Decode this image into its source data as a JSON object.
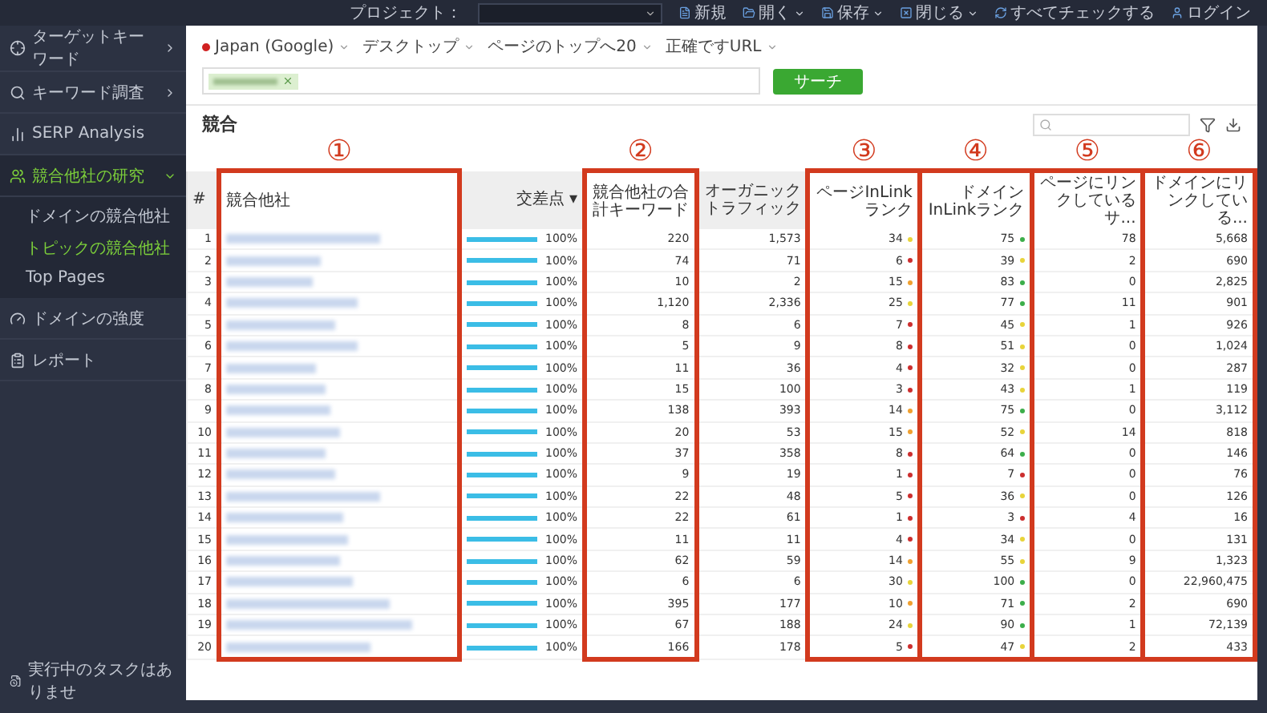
{
  "top_bar": {
    "project_label": "プロジェクト：",
    "actions": [
      {
        "label": "新規",
        "dropdown": false
      },
      {
        "label": "開く",
        "dropdown": true
      },
      {
        "label": "保存",
        "dropdown": true
      },
      {
        "label": "閉じる",
        "dropdown": true
      },
      {
        "label": "すべてチェックする",
        "dropdown": false
      },
      {
        "label": "ログイン",
        "dropdown": false
      }
    ]
  },
  "sidebar": {
    "items": [
      {
        "label": "ターゲットキーワード",
        "selected": false,
        "expanded": false
      },
      {
        "label": "キーワード調査",
        "selected": false,
        "expanded": false
      },
      {
        "label": "SERP Analysis",
        "selected": false
      },
      {
        "label": "競合他社の研究",
        "selected": true,
        "expanded": true,
        "children": [
          {
            "label": "ドメインの競合他社",
            "selected": false
          },
          {
            "label": "トピックの競合他社",
            "selected": true
          },
          {
            "label": "Top Pages",
            "selected": false
          }
        ]
      },
      {
        "label": "ドメインの強度",
        "selected": false
      },
      {
        "label": "レポート",
        "selected": false
      }
    ],
    "status": "実行中のタスクはありませ"
  },
  "filters": [
    {
      "label": "Japan (Google)",
      "flag": true
    },
    {
      "label": "デスクトップ",
      "flag": false
    },
    {
      "label": "ページのトップへ20",
      "flag": false
    },
    {
      "label": "正確ですURL",
      "flag": false
    }
  ],
  "search": {
    "button": "サーチ"
  },
  "results": {
    "title": "競合",
    "columns": [
      {
        "label": "#",
        "highlight": false
      },
      {
        "label": "競合他社",
        "highlight": true,
        "callout": "①"
      },
      {
        "label": "交差点 ▾",
        "highlight": false
      },
      {
        "label": "競合他社の合計キーワード",
        "highlight": true,
        "callout": "②"
      },
      {
        "label": "オーガニックトラフィック",
        "highlight": false
      },
      {
        "label": "ページInLinkランク",
        "highlight": true,
        "callout": "③"
      },
      {
        "label": "ドメインInLinkランク",
        "highlight": true,
        "callout": "④"
      },
      {
        "label": "ページにリンクしているサ...",
        "highlight": true,
        "callout": "⑤"
      },
      {
        "label": "ドメインにリンクしている...",
        "highlight": true,
        "callout": "⑥"
      }
    ],
    "rows": [
      {
        "n": "1",
        "level": 1,
        "reading": "100%",
        "keywords": "220",
        "traffic": "1,573",
        "page_rank": {
          "value": "34",
          "color": "#e8d43a"
        },
        "domain_rank": {
          "value": "75",
          "color": "#3cae4a"
        },
        "page_links": "78",
        "domain_links": "5,668"
      },
      {
        "n": "2",
        "level": 1,
        "reading": "100%",
        "keywords": "74",
        "traffic": "71",
        "page_rank": {
          "value": "6",
          "color": "#cc2e2e"
        },
        "domain_rank": {
          "value": "39",
          "color": "#e8d43a"
        },
        "page_links": "2",
        "domain_links": "690"
      },
      {
        "n": "3",
        "level": 1,
        "reading": "100%",
        "keywords": "10",
        "traffic": "2",
        "page_rank": {
          "value": "15",
          "color": "#f0a030"
        },
        "domain_rank": {
          "value": "83",
          "color": "#3cae4a"
        },
        "page_links": "0",
        "domain_links": "2,825"
      },
      {
        "n": "4",
        "level": 1,
        "reading": "100%",
        "keywords": "1,120",
        "traffic": "2,336",
        "page_rank": {
          "value": "25",
          "color": "#e8d43a"
        },
        "domain_rank": {
          "value": "77",
          "color": "#3cae4a"
        },
        "page_links": "11",
        "domain_links": "901"
      },
      {
        "n": "5",
        "level": 1,
        "reading": "100%",
        "keywords": "8",
        "traffic": "6",
        "page_rank": {
          "value": "7",
          "color": "#cc2e2e"
        },
        "domain_rank": {
          "value": "45",
          "color": "#e8d43a"
        },
        "page_links": "1",
        "domain_links": "926"
      },
      {
        "n": "6",
        "level": 1,
        "reading": "100%",
        "keywords": "5",
        "traffic": "9",
        "page_rank": {
          "value": "8",
          "color": "#cc2e2e"
        },
        "domain_rank": {
          "value": "51",
          "color": "#e8d43a"
        },
        "page_links": "0",
        "domain_links": "1,024"
      },
      {
        "n": "7",
        "level": 1,
        "reading": "100%",
        "keywords": "11",
        "traffic": "36",
        "page_rank": {
          "value": "4",
          "color": "#cc2e2e"
        },
        "domain_rank": {
          "value": "32",
          "color": "#e8d43a"
        },
        "page_links": "0",
        "domain_links": "287"
      },
      {
        "n": "8",
        "level": 1,
        "reading": "100%",
        "keywords": "15",
        "traffic": "100",
        "page_rank": {
          "value": "3",
          "color": "#cc2e2e"
        },
        "domain_rank": {
          "value": "43",
          "color": "#e8d43a"
        },
        "page_links": "1",
        "domain_links": "119"
      },
      {
        "n": "9",
        "level": 1,
        "reading": "100%",
        "keywords": "138",
        "traffic": "393",
        "page_rank": {
          "value": "14",
          "color": "#f0a030"
        },
        "domain_rank": {
          "value": "75",
          "color": "#3cae4a"
        },
        "page_links": "0",
        "domain_links": "3,112"
      },
      {
        "n": "10",
        "level": 1,
        "reading": "100%",
        "keywords": "20",
        "traffic": "53",
        "page_rank": {
          "value": "15",
          "color": "#f0a030"
        },
        "domain_rank": {
          "value": "52",
          "color": "#e8d43a"
        },
        "page_links": "14",
        "domain_links": "818"
      },
      {
        "n": "11",
        "level": 1,
        "reading": "100%",
        "keywords": "37",
        "traffic": "358",
        "page_rank": {
          "value": "8",
          "color": "#cc2e2e"
        },
        "domain_rank": {
          "value": "64",
          "color": "#3cae4a"
        },
        "page_links": "0",
        "domain_links": "146"
      },
      {
        "n": "12",
        "level": 1,
        "reading": "100%",
        "keywords": "9",
        "traffic": "19",
        "page_rank": {
          "value": "1",
          "color": "#cc2e2e"
        },
        "domain_rank": {
          "value": "7",
          "color": "#cc2e2e"
        },
        "page_links": "0",
        "domain_links": "76"
      },
      {
        "n": "13",
        "level": 1,
        "reading": "100%",
        "keywords": "22",
        "traffic": "48",
        "page_rank": {
          "value": "5",
          "color": "#cc2e2e"
        },
        "domain_rank": {
          "value": "36",
          "color": "#e8d43a"
        },
        "page_links": "0",
        "domain_links": "126"
      },
      {
        "n": "14",
        "level": 1,
        "reading": "100%",
        "keywords": "22",
        "traffic": "61",
        "page_rank": {
          "value": "1",
          "color": "#cc2e2e"
        },
        "domain_rank": {
          "value": "3",
          "color": "#cc2e2e"
        },
        "page_links": "4",
        "domain_links": "16"
      },
      {
        "n": "15",
        "level": 1,
        "reading": "100%",
        "keywords": "11",
        "traffic": "11",
        "page_rank": {
          "value": "4",
          "color": "#cc2e2e"
        },
        "domain_rank": {
          "value": "34",
          "color": "#e8d43a"
        },
        "page_links": "0",
        "domain_links": "131"
      },
      {
        "n": "16",
        "level": 1,
        "reading": "100%",
        "keywords": "62",
        "traffic": "59",
        "page_rank": {
          "value": "14",
          "color": "#f0a030"
        },
        "domain_rank": {
          "value": "55",
          "color": "#e8d43a"
        },
        "page_links": "9",
        "domain_links": "1,323"
      },
      {
        "n": "17",
        "level": 1,
        "reading": "100%",
        "keywords": "6",
        "traffic": "6",
        "page_rank": {
          "value": "30",
          "color": "#e8d43a"
        },
        "domain_rank": {
          "value": "100",
          "color": "#3cae4a"
        },
        "page_links": "0",
        "domain_links": "22,960,475"
      },
      {
        "n": "18",
        "level": 1,
        "reading": "100%",
        "keywords": "395",
        "traffic": "177",
        "page_rank": {
          "value": "10",
          "color": "#f0a030"
        },
        "domain_rank": {
          "value": "71",
          "color": "#3cae4a"
        },
        "page_links": "2",
        "domain_links": "690"
      },
      {
        "n": "19",
        "level": 1,
        "reading": "100%",
        "keywords": "67",
        "traffic": "188",
        "page_rank": {
          "value": "24",
          "color": "#e8d43a"
        },
        "domain_rank": {
          "value": "90",
          "color": "#3cae4a"
        },
        "page_links": "1",
        "domain_links": "72,139"
      },
      {
        "n": "20",
        "level": 1,
        "reading": "100%",
        "keywords": "166",
        "traffic": "178",
        "page_rank": {
          "value": "5",
          "color": "#cc2e2e"
        },
        "domain_rank": {
          "value": "47",
          "color": "#e8d43a"
        },
        "page_links": "2",
        "domain_links": "433"
      }
    ]
  }
}
